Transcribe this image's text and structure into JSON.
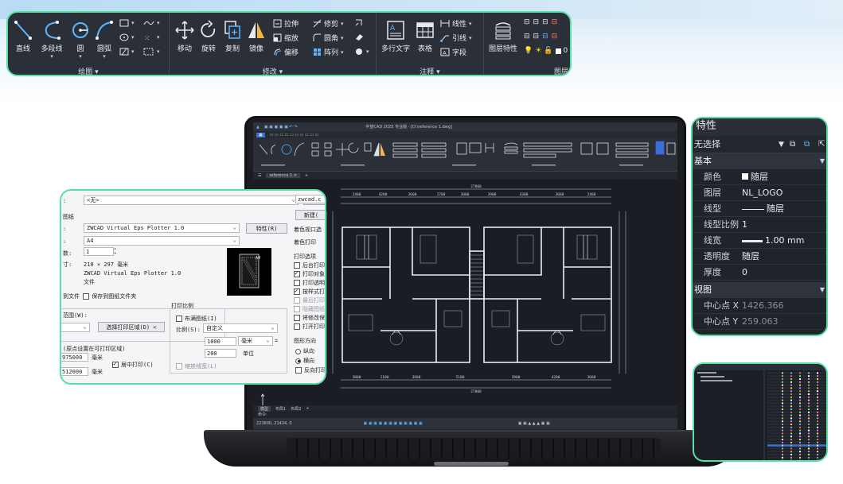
{
  "ribbon": {
    "draw": {
      "title": "绘图",
      "line": "直线",
      "polyline": "多段线",
      "circle": "圆",
      "arc": "圆弧"
    },
    "modify": {
      "title": "修改",
      "move": "移动",
      "rotate": "旋转",
      "copy": "复制",
      "mirror": "镜像",
      "stretch": "拉伸",
      "trim": "修剪",
      "scale": "缩放",
      "fillet": "圆角",
      "offset": "偏移",
      "array": "阵列"
    },
    "annotation": {
      "title": "注释",
      "mtext": "多行文字",
      "table": "表格",
      "linear": "线性",
      "leader": "引线",
      "field": "字段"
    },
    "layers": {
      "title": "图层",
      "layer_props": "图层特性",
      "layer_value": "0"
    }
  },
  "cad": {
    "title": "中望CAD 2025 专业版 - [D:\\reference 1.dwg]",
    "tab": "reference 1",
    "layout_tabs": [
      "模型",
      "布局1",
      "布局2"
    ],
    "command_prompt": "命令:",
    "coords": "223600, 21434, 0",
    "dims_top": [
      "2400",
      "4200",
      "3600",
      "1700",
      "3000",
      "3900",
      "4300",
      "3600",
      "2400"
    ],
    "dims_bottom": [
      "3000",
      "2100",
      "3600",
      "5100",
      "3900",
      "4200",
      "3600"
    ],
    "dim_total": "27800"
  },
  "print_dialog": {
    "preset_value": "<无>",
    "new_button": "新建(N)",
    "printer_label": "图纸",
    "printer_value": "ZWCAD Virtual Eps Plotter 1.0",
    "properties_button": "特性(R)",
    "paper_value": "A4",
    "copies_value": "1",
    "size_value": "210 × 297  毫米",
    "size_plotter": "ZWCAD Virtual Eps Plotter 1.0",
    "size_file": "文件",
    "save_drawing_file": "保存到图纸文件夹",
    "area_label": "范围(W):",
    "select_area_button": "选择打印区域(D) <",
    "scale_title": "打印比例",
    "fit_paper": "布满图纸(I)",
    "scale_label": "比例(S):",
    "scale_value": "自定义",
    "scale_num": "1000",
    "scale_unit": "毫米",
    "scale_den": "200",
    "scale_den_unit": "单位",
    "lineweight_scale": "缩放线宽(L)",
    "offset_label": "(原点设置在可打印区域)",
    "offset_x": "975000",
    "offset_x_unit": "毫米",
    "offset_y": "512000",
    "offset_y_unit": "毫米",
    "center_plot": "居中打印(C)",
    "right_top_field": "zwcad.c",
    "right_new": "新建(",
    "shade_title": "着色视口选",
    "shade_print": "着色打印",
    "options_title": "打印选项",
    "opt_bg": "后台打印",
    "opt_objects": "打印对象",
    "opt_transparency": "打印透明",
    "opt_styles": "按样式打",
    "opt_last": "最后打印",
    "opt_hide": "隐藏图纸",
    "opt_log": "将修改保",
    "opt_stamp": "打开打印",
    "orient_title": "图形方向",
    "orient_portrait": "纵向",
    "orient_landscape": "横向",
    "orient_reverse": "反向打印"
  },
  "properties": {
    "title": "特性",
    "selection": "无选择",
    "basic_section": "基本",
    "rows": [
      {
        "key": "颜色",
        "value": "随层"
      },
      {
        "key": "图层",
        "value": "NL_LOGO"
      },
      {
        "key": "线型",
        "value": "随层"
      },
      {
        "key": "线型比例",
        "value": "1"
      },
      {
        "key": "线宽",
        "value": "1.00 mm"
      },
      {
        "key": "透明度",
        "value": "随层"
      },
      {
        "key": "厚度",
        "value": "0"
      }
    ],
    "view_section": "视图",
    "view_rows": [
      {
        "key": "中心点 X",
        "value": "1426.366"
      },
      {
        "key": "中心点 Y",
        "value": "259.063"
      }
    ]
  },
  "colors": {
    "accent_border": "#58e0a7",
    "panel_dark": "#2b2f38",
    "cad_bg": "#1a1d23"
  }
}
